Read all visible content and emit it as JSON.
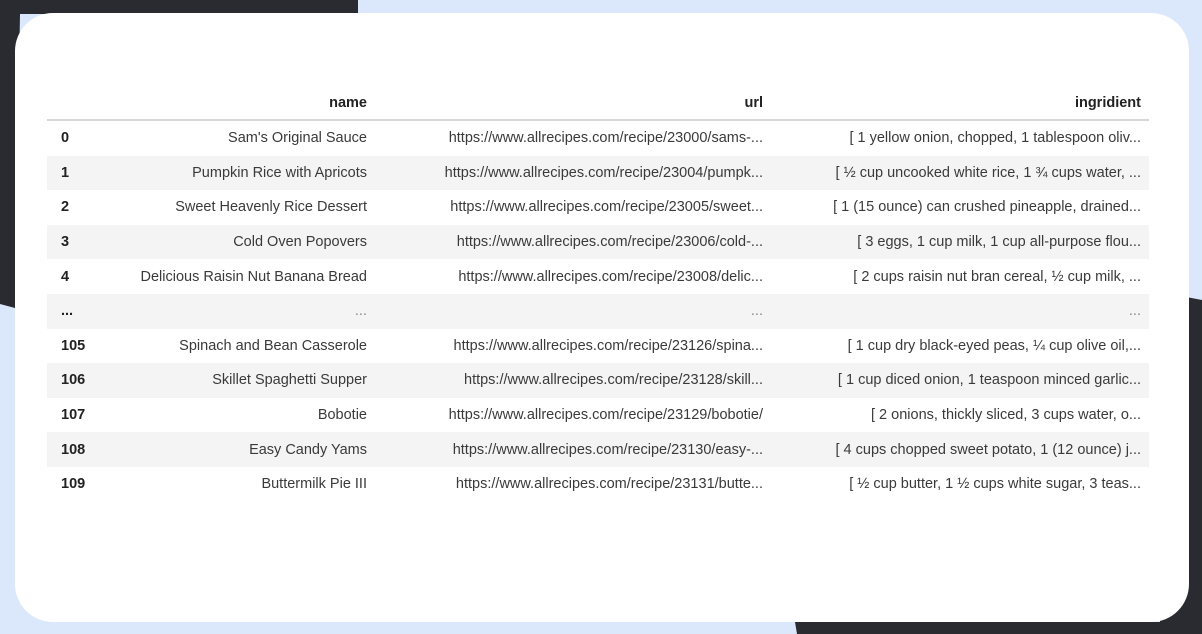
{
  "table": {
    "columns": [
      "name",
      "url",
      "ingridient"
    ],
    "rows": [
      {
        "index": "0",
        "name": "Sam's Original Sauce",
        "url": "https://www.allrecipes.com/recipe/23000/sams-...",
        "ingridient": "[ 1 yellow onion, chopped, 1 tablespoon oliv..."
      },
      {
        "index": "1",
        "name": "Pumpkin Rice with Apricots",
        "url": "https://www.allrecipes.com/recipe/23004/pumpk...",
        "ingridient": "[ ½ cup uncooked white rice, 1 ¾ cups water, ..."
      },
      {
        "index": "2",
        "name": "Sweet Heavenly Rice Dessert",
        "url": "https://www.allrecipes.com/recipe/23005/sweet...",
        "ingridient": "[ 1 (15 ounce) can crushed pineapple, drained..."
      },
      {
        "index": "3",
        "name": "Cold Oven Popovers",
        "url": "https://www.allrecipes.com/recipe/23006/cold-...",
        "ingridient": "[ 3 eggs, 1 cup milk, 1 cup all-purpose flou..."
      },
      {
        "index": "4",
        "name": "Delicious Raisin Nut Banana Bread",
        "url": "https://www.allrecipes.com/recipe/23008/delic...",
        "ingridient": "[ 2 cups raisin nut bran cereal, ½ cup milk, ..."
      },
      {
        "index": "...",
        "name": "...",
        "url": "...",
        "ingridient": "..."
      },
      {
        "index": "105",
        "name": "Spinach and Bean Casserole",
        "url": "https://www.allrecipes.com/recipe/23126/spina...",
        "ingridient": "[ 1 cup dry black-eyed peas, ¼ cup olive oil,..."
      },
      {
        "index": "106",
        "name": "Skillet Spaghetti Supper",
        "url": "https://www.allrecipes.com/recipe/23128/skill...",
        "ingridient": "[ 1 cup diced onion, 1 teaspoon minced garlic..."
      },
      {
        "index": "107",
        "name": "Bobotie",
        "url": "https://www.allrecipes.com/recipe/23129/bobotie/",
        "ingridient": "[ 2 onions, thickly sliced, 3 cups water, o..."
      },
      {
        "index": "108",
        "name": "Easy Candy Yams",
        "url": "https://www.allrecipes.com/recipe/23130/easy-...",
        "ingridient": "[ 4 cups chopped sweet potato, 1 (12 ounce) j..."
      },
      {
        "index": "109",
        "name": "Buttermilk Pie III",
        "url": "https://www.allrecipes.com/recipe/23131/butte...",
        "ingridient": "[ ½ cup butter, 1 ½ cups white sugar, 3 teas..."
      }
    ]
  },
  "colors": {
    "background": "#dbe8fb",
    "dark_accent": "#2a2b31",
    "card": "#ffffff",
    "stripe": "#f4f4f4"
  }
}
